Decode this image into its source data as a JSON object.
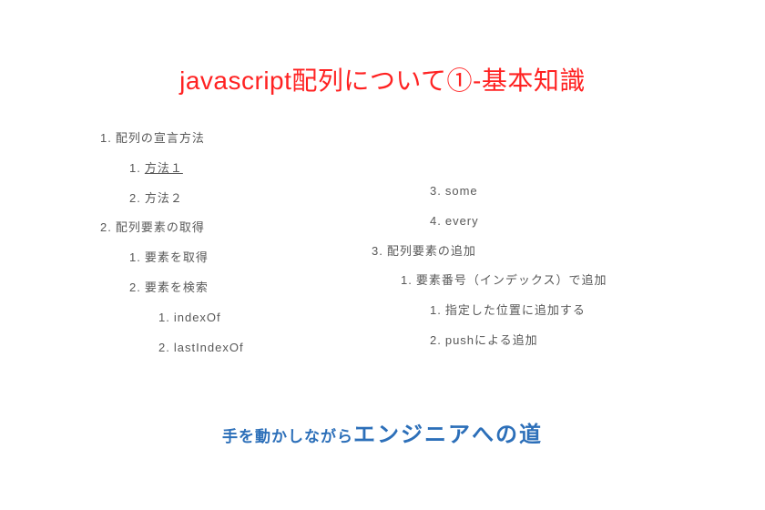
{
  "title": "javascript配列について①-基本知識",
  "toc_left": [
    {
      "level": 1,
      "num": "1.",
      "text": "配列の宣言方法",
      "link": false
    },
    {
      "level": 2,
      "num": "1.",
      "text": "方法１",
      "link": true
    },
    {
      "level": 2,
      "num": "2.",
      "text": "方法２",
      "link": false
    },
    {
      "level": 1,
      "num": "2.",
      "text": "配列要素の取得",
      "link": false
    },
    {
      "level": 2,
      "num": "1.",
      "text": "要素を取得",
      "link": false
    },
    {
      "level": 2,
      "num": "2.",
      "text": "要素を検索",
      "link": false
    },
    {
      "level": 3,
      "num": "1.",
      "text": "indexOf",
      "link": false
    },
    {
      "level": 3,
      "num": "2.",
      "text": "lastIndexOf",
      "link": false
    }
  ],
  "toc_right": [
    {
      "level": 3,
      "num": "3.",
      "text": "some",
      "link": false
    },
    {
      "level": 3,
      "num": "4.",
      "text": "every",
      "link": false
    },
    {
      "level": 1,
      "num": "3.",
      "text": "配列要素の追加",
      "link": false
    },
    {
      "level": 2,
      "num": "1.",
      "text": "要素番号（インデックス）で追加",
      "link": false
    },
    {
      "level": 3,
      "num": "1.",
      "text": "指定した位置に追加する",
      "link": false
    },
    {
      "level": 3,
      "num": "2.",
      "text": "pushによる追加",
      "link": false
    }
  ],
  "footer": {
    "small": "手を動かしながら",
    "big": "エンジニアへの道"
  }
}
